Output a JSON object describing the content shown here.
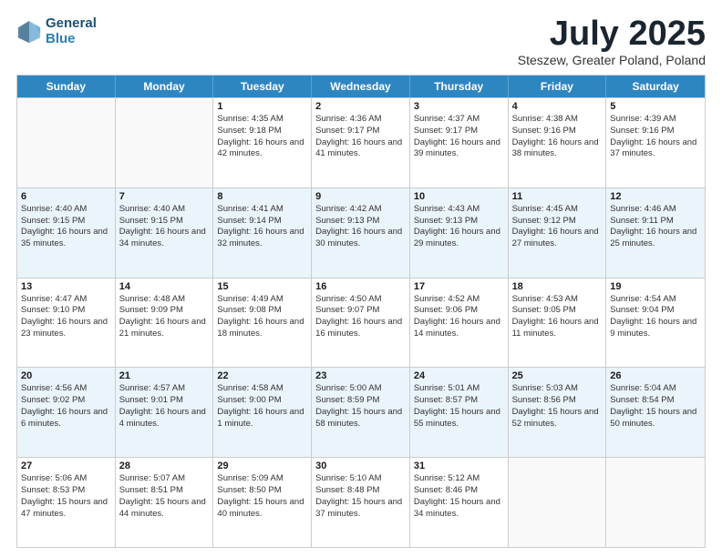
{
  "header": {
    "logo_line1": "General",
    "logo_line2": "Blue",
    "month": "July 2025",
    "location": "Steszew, Greater Poland, Poland"
  },
  "weekdays": [
    "Sunday",
    "Monday",
    "Tuesday",
    "Wednesday",
    "Thursday",
    "Friday",
    "Saturday"
  ],
  "rows": [
    [
      {
        "day": "",
        "sunrise": "",
        "sunset": "",
        "daylight": "",
        "empty": true
      },
      {
        "day": "",
        "sunrise": "",
        "sunset": "",
        "daylight": "",
        "empty": true
      },
      {
        "day": "1",
        "sunrise": "Sunrise: 4:35 AM",
        "sunset": "Sunset: 9:18 PM",
        "daylight": "Daylight: 16 hours and 42 minutes.",
        "empty": false
      },
      {
        "day": "2",
        "sunrise": "Sunrise: 4:36 AM",
        "sunset": "Sunset: 9:17 PM",
        "daylight": "Daylight: 16 hours and 41 minutes.",
        "empty": false
      },
      {
        "day": "3",
        "sunrise": "Sunrise: 4:37 AM",
        "sunset": "Sunset: 9:17 PM",
        "daylight": "Daylight: 16 hours and 39 minutes.",
        "empty": false
      },
      {
        "day": "4",
        "sunrise": "Sunrise: 4:38 AM",
        "sunset": "Sunset: 9:16 PM",
        "daylight": "Daylight: 16 hours and 38 minutes.",
        "empty": false
      },
      {
        "day": "5",
        "sunrise": "Sunrise: 4:39 AM",
        "sunset": "Sunset: 9:16 PM",
        "daylight": "Daylight: 16 hours and 37 minutes.",
        "empty": false
      }
    ],
    [
      {
        "day": "6",
        "sunrise": "Sunrise: 4:40 AM",
        "sunset": "Sunset: 9:15 PM",
        "daylight": "Daylight: 16 hours and 35 minutes.",
        "empty": false
      },
      {
        "day": "7",
        "sunrise": "Sunrise: 4:40 AM",
        "sunset": "Sunset: 9:15 PM",
        "daylight": "Daylight: 16 hours and 34 minutes.",
        "empty": false
      },
      {
        "day": "8",
        "sunrise": "Sunrise: 4:41 AM",
        "sunset": "Sunset: 9:14 PM",
        "daylight": "Daylight: 16 hours and 32 minutes.",
        "empty": false
      },
      {
        "day": "9",
        "sunrise": "Sunrise: 4:42 AM",
        "sunset": "Sunset: 9:13 PM",
        "daylight": "Daylight: 16 hours and 30 minutes.",
        "empty": false
      },
      {
        "day": "10",
        "sunrise": "Sunrise: 4:43 AM",
        "sunset": "Sunset: 9:13 PM",
        "daylight": "Daylight: 16 hours and 29 minutes.",
        "empty": false
      },
      {
        "day": "11",
        "sunrise": "Sunrise: 4:45 AM",
        "sunset": "Sunset: 9:12 PM",
        "daylight": "Daylight: 16 hours and 27 minutes.",
        "empty": false
      },
      {
        "day": "12",
        "sunrise": "Sunrise: 4:46 AM",
        "sunset": "Sunset: 9:11 PM",
        "daylight": "Daylight: 16 hours and 25 minutes.",
        "empty": false
      }
    ],
    [
      {
        "day": "13",
        "sunrise": "Sunrise: 4:47 AM",
        "sunset": "Sunset: 9:10 PM",
        "daylight": "Daylight: 16 hours and 23 minutes.",
        "empty": false
      },
      {
        "day": "14",
        "sunrise": "Sunrise: 4:48 AM",
        "sunset": "Sunset: 9:09 PM",
        "daylight": "Daylight: 16 hours and 21 minutes.",
        "empty": false
      },
      {
        "day": "15",
        "sunrise": "Sunrise: 4:49 AM",
        "sunset": "Sunset: 9:08 PM",
        "daylight": "Daylight: 16 hours and 18 minutes.",
        "empty": false
      },
      {
        "day": "16",
        "sunrise": "Sunrise: 4:50 AM",
        "sunset": "Sunset: 9:07 PM",
        "daylight": "Daylight: 16 hours and 16 minutes.",
        "empty": false
      },
      {
        "day": "17",
        "sunrise": "Sunrise: 4:52 AM",
        "sunset": "Sunset: 9:06 PM",
        "daylight": "Daylight: 16 hours and 14 minutes.",
        "empty": false
      },
      {
        "day": "18",
        "sunrise": "Sunrise: 4:53 AM",
        "sunset": "Sunset: 9:05 PM",
        "daylight": "Daylight: 16 hours and 11 minutes.",
        "empty": false
      },
      {
        "day": "19",
        "sunrise": "Sunrise: 4:54 AM",
        "sunset": "Sunset: 9:04 PM",
        "daylight": "Daylight: 16 hours and 9 minutes.",
        "empty": false
      }
    ],
    [
      {
        "day": "20",
        "sunrise": "Sunrise: 4:56 AM",
        "sunset": "Sunset: 9:02 PM",
        "daylight": "Daylight: 16 hours and 6 minutes.",
        "empty": false
      },
      {
        "day": "21",
        "sunrise": "Sunrise: 4:57 AM",
        "sunset": "Sunset: 9:01 PM",
        "daylight": "Daylight: 16 hours and 4 minutes.",
        "empty": false
      },
      {
        "day": "22",
        "sunrise": "Sunrise: 4:58 AM",
        "sunset": "Sunset: 9:00 PM",
        "daylight": "Daylight: 16 hours and 1 minute.",
        "empty": false
      },
      {
        "day": "23",
        "sunrise": "Sunrise: 5:00 AM",
        "sunset": "Sunset: 8:59 PM",
        "daylight": "Daylight: 15 hours and 58 minutes.",
        "empty": false
      },
      {
        "day": "24",
        "sunrise": "Sunrise: 5:01 AM",
        "sunset": "Sunset: 8:57 PM",
        "daylight": "Daylight: 15 hours and 55 minutes.",
        "empty": false
      },
      {
        "day": "25",
        "sunrise": "Sunrise: 5:03 AM",
        "sunset": "Sunset: 8:56 PM",
        "daylight": "Daylight: 15 hours and 52 minutes.",
        "empty": false
      },
      {
        "day": "26",
        "sunrise": "Sunrise: 5:04 AM",
        "sunset": "Sunset: 8:54 PM",
        "daylight": "Daylight: 15 hours and 50 minutes.",
        "empty": false
      }
    ],
    [
      {
        "day": "27",
        "sunrise": "Sunrise: 5:06 AM",
        "sunset": "Sunset: 8:53 PM",
        "daylight": "Daylight: 15 hours and 47 minutes.",
        "empty": false
      },
      {
        "day": "28",
        "sunrise": "Sunrise: 5:07 AM",
        "sunset": "Sunset: 8:51 PM",
        "daylight": "Daylight: 15 hours and 44 minutes.",
        "empty": false
      },
      {
        "day": "29",
        "sunrise": "Sunrise: 5:09 AM",
        "sunset": "Sunset: 8:50 PM",
        "daylight": "Daylight: 15 hours and 40 minutes.",
        "empty": false
      },
      {
        "day": "30",
        "sunrise": "Sunrise: 5:10 AM",
        "sunset": "Sunset: 8:48 PM",
        "daylight": "Daylight: 15 hours and 37 minutes.",
        "empty": false
      },
      {
        "day": "31",
        "sunrise": "Sunrise: 5:12 AM",
        "sunset": "Sunset: 8:46 PM",
        "daylight": "Daylight: 15 hours and 34 minutes.",
        "empty": false
      },
      {
        "day": "",
        "sunrise": "",
        "sunset": "",
        "daylight": "",
        "empty": true
      },
      {
        "day": "",
        "sunrise": "",
        "sunset": "",
        "daylight": "",
        "empty": true
      }
    ]
  ]
}
